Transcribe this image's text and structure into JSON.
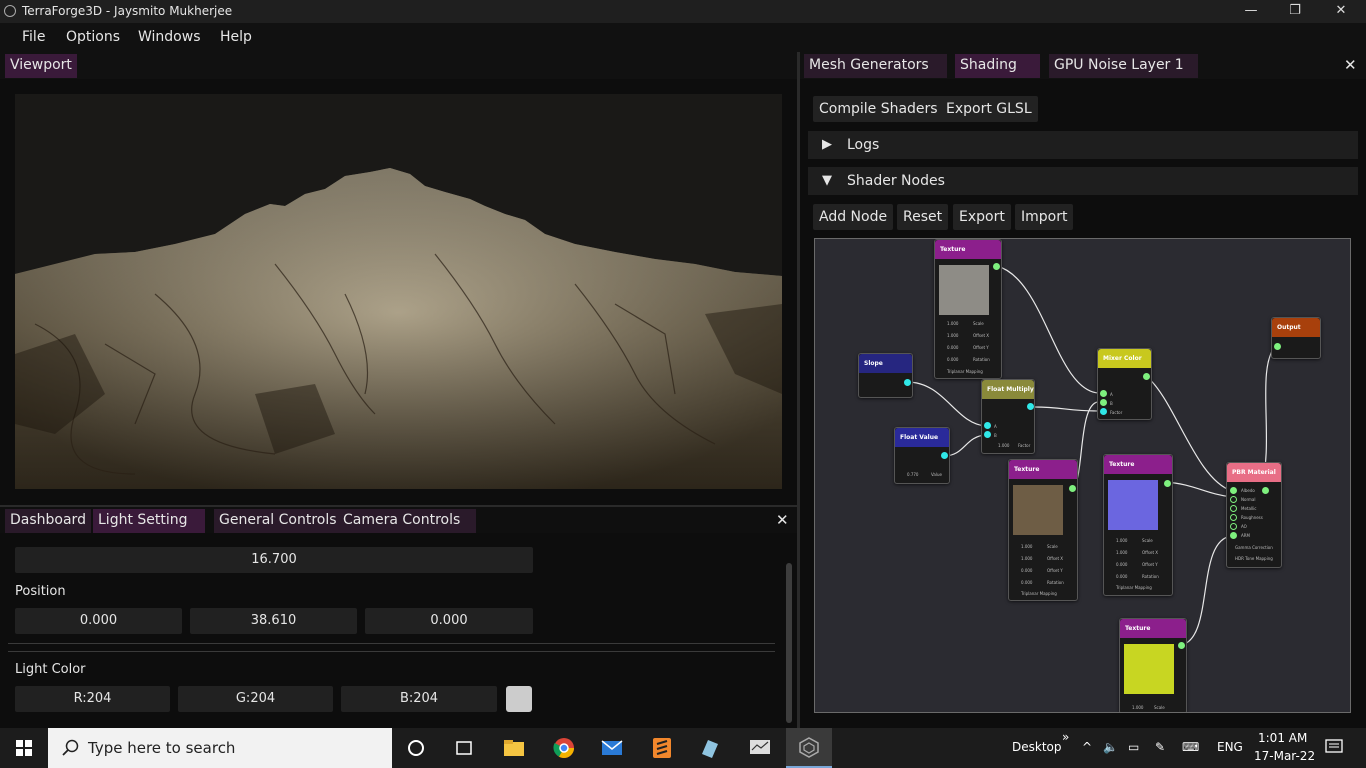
{
  "window": {
    "title": "TerraForge3D - Jaysmito Mukherjee",
    "min": "—",
    "max": "❐",
    "close": "✕"
  },
  "menu": [
    "File",
    "Options",
    "Windows",
    "Help"
  ],
  "viewport": {
    "tab": "Viewport"
  },
  "dashboard": {
    "tabs": [
      "Dashboard",
      "Light Setting",
      "General Controls",
      "Camera Controls"
    ],
    "close": "✕",
    "strength_value": "16.700",
    "position_label": "Position",
    "position": [
      "0.000",
      "38.610",
      "0.000"
    ],
    "light_color_label": "Light Color",
    "light_color": [
      "R:204",
      "G:204",
      "B:204"
    ],
    "swatch_color": "#cccccc"
  },
  "right_panel": {
    "tabs": [
      "Mesh Generators",
      "Shading",
      "GPU Noise Layer 1"
    ],
    "close": "✕",
    "buttons": [
      "Compile Shaders",
      "Export GLSL"
    ],
    "sections": [
      {
        "arrow": "▶",
        "label": "Logs"
      },
      {
        "arrow": "▼",
        "label": "Shader Nodes"
      }
    ],
    "node_buttons": [
      "Add Node",
      "Reset",
      "Export",
      "Import"
    ]
  },
  "nodes": {
    "texture_top": {
      "title": "Texture",
      "rows": [
        "Scale",
        "Offset X",
        "Offset Y",
        "Rotation"
      ],
      "vals": [
        "1.000",
        "1.000",
        "0.000",
        "0.000"
      ],
      "check": "Triplanar Mapping"
    },
    "slope": {
      "title": "Slope"
    },
    "float_multiply": {
      "title": "Float Multiply",
      "rows": [
        "A",
        "B"
      ],
      "val": "1.000",
      "out": "Factor"
    },
    "float_value": {
      "title": "Float Value",
      "val": "0.770",
      "out": "Value"
    },
    "mix_color": {
      "title": "Mixer Color",
      "rows": [
        "A",
        "B",
        "Factor"
      ]
    },
    "output": {
      "title": "Output"
    },
    "texture_mid": {
      "title": "Texture",
      "rows": [
        "Scale",
        "Offset X",
        "Offset Y",
        "Rotation"
      ],
      "vals": [
        "1.000",
        "1.000",
        "0.000",
        "0.000"
      ],
      "check": "Triplanar Mapping"
    },
    "texture_normal": {
      "title": "Texture",
      "rows": [
        "Scale",
        "Offset X",
        "Offset Y",
        "Rotation"
      ],
      "vals": [
        "1.000",
        "1.000",
        "0.000",
        "0.000"
      ],
      "check": "Triplanar Mapping"
    },
    "pbr": {
      "title": "PBR Material",
      "rows": [
        "Albedo",
        "Normal",
        "Metallic",
        "Roughness",
        "AO",
        "ARM"
      ],
      "checks": [
        "Gamma Correction",
        "HDR Tone Mapping"
      ]
    },
    "texture_bottom": {
      "title": "Texture",
      "val": "1.000",
      "out": "Scale"
    }
  },
  "taskbar": {
    "search_placeholder": "Type here to search",
    "desktop": "Desktop",
    "chevron": "»",
    "lang": "ENG",
    "time": "1:01 AM",
    "date": "17-Mar-22"
  },
  "colors": {
    "tab_active": "#3a1a3a",
    "texture_header": "#8c1f8c",
    "slope_header": "#262680",
    "float_multiply_header": "#8a8a3a",
    "float_value_header": "#2a2a9a",
    "mix_color_header": "#c8c81e",
    "output_header": "#a8400c",
    "pbr_header": "#e86e86"
  }
}
